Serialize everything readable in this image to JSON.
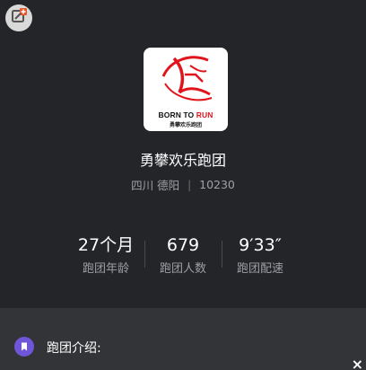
{
  "header": {
    "edit_icon": "edit-icon"
  },
  "logo": {
    "line1_a": "BORN TO ",
    "line1_b": "RUN",
    "line2": "勇攀欢乐跑团",
    "accent": "#e1141b"
  },
  "club": {
    "name": "勇攀欢乐跑团",
    "location": "四川 德阳",
    "separator": "|",
    "id": "10230"
  },
  "stats": [
    {
      "value": "27个月",
      "label": "跑团年龄"
    },
    {
      "value": "679",
      "label": "跑团人数"
    },
    {
      "value": "9′33″",
      "label": "跑团配速"
    }
  ],
  "intro": {
    "label": "跑团介绍:",
    "icon": "bookmark-icon",
    "icon_color": "#6f56d9"
  },
  "close": {
    "glyph": "×"
  }
}
